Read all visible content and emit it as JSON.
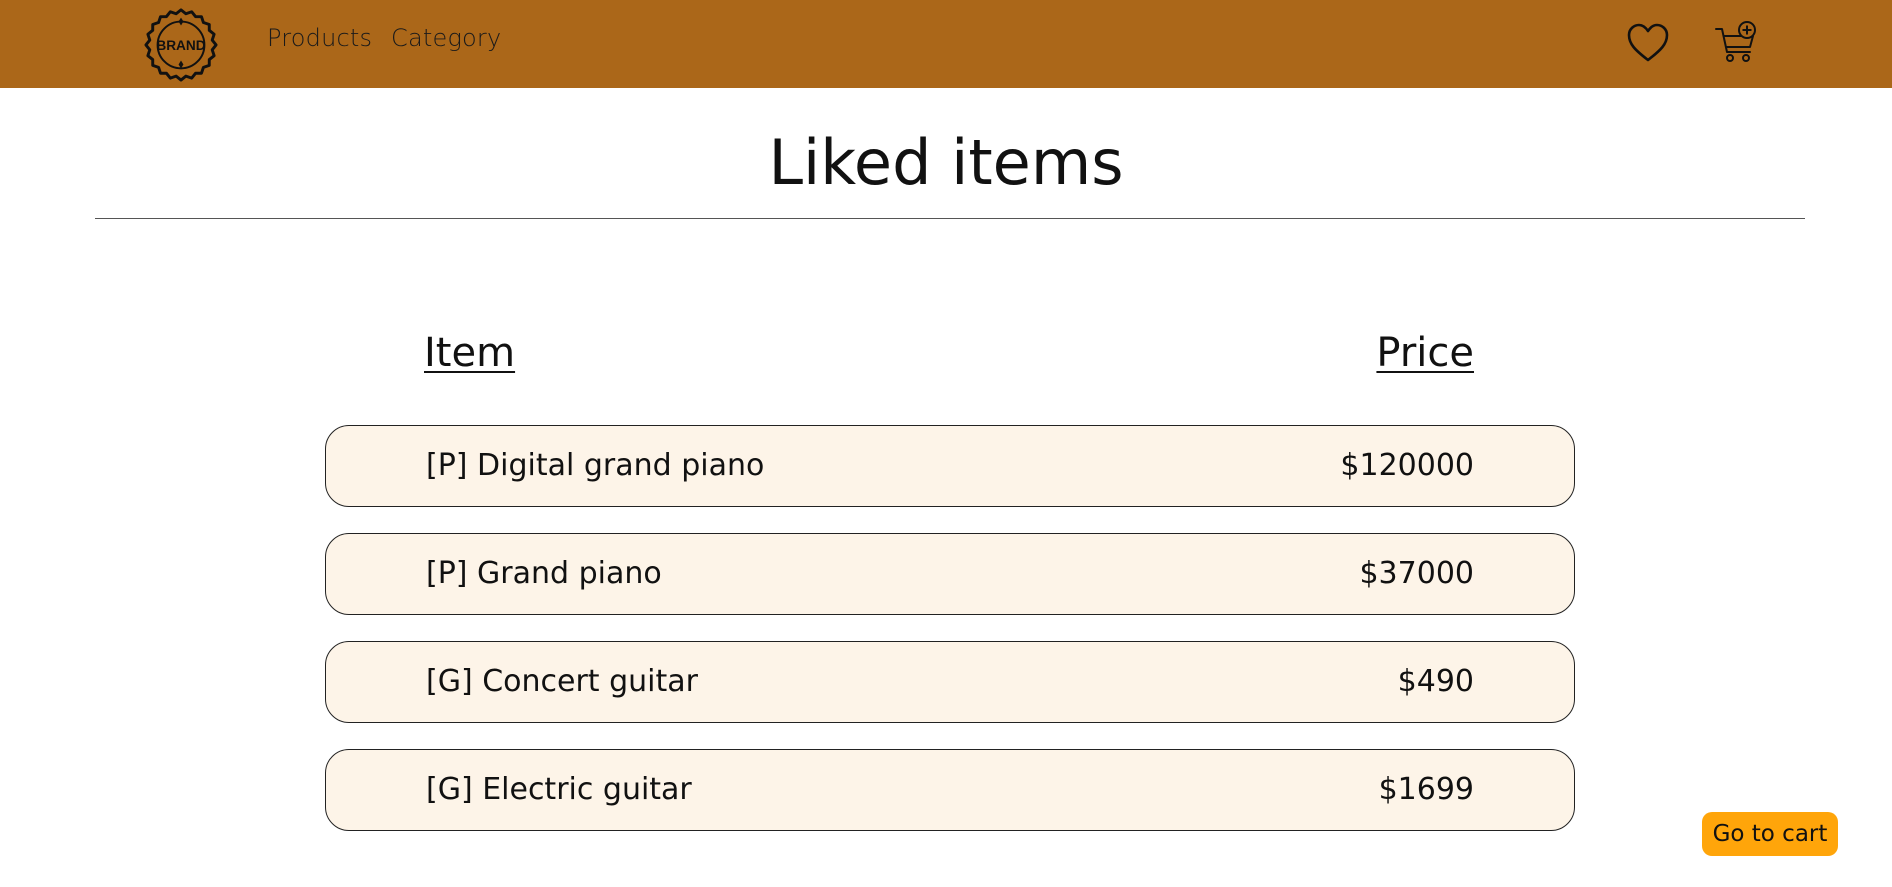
{
  "brand": {
    "logo_text": "BRAND",
    "logo_icon": "badge-logo"
  },
  "nav": {
    "links": [
      "Products",
      "Category"
    ],
    "icons": [
      "heart-icon",
      "cart-add-icon"
    ]
  },
  "colors": {
    "navbar": "#ab6719",
    "row_background": "#fdf4e8",
    "cart_button": "#ffa50a"
  },
  "page": {
    "title": "Liked items"
  },
  "table": {
    "headers": {
      "item": "Item",
      "price": "Price"
    },
    "rows": [
      {
        "name": "[P] Digital grand piano",
        "price": "$120000"
      },
      {
        "name": "[P] Grand piano",
        "price": "$37000"
      },
      {
        "name": "[G] Concert guitar",
        "price": "$490"
      },
      {
        "name": "[G] Electric guitar",
        "price": "$1699"
      }
    ]
  },
  "actions": {
    "go_to_cart": "Go to cart"
  }
}
